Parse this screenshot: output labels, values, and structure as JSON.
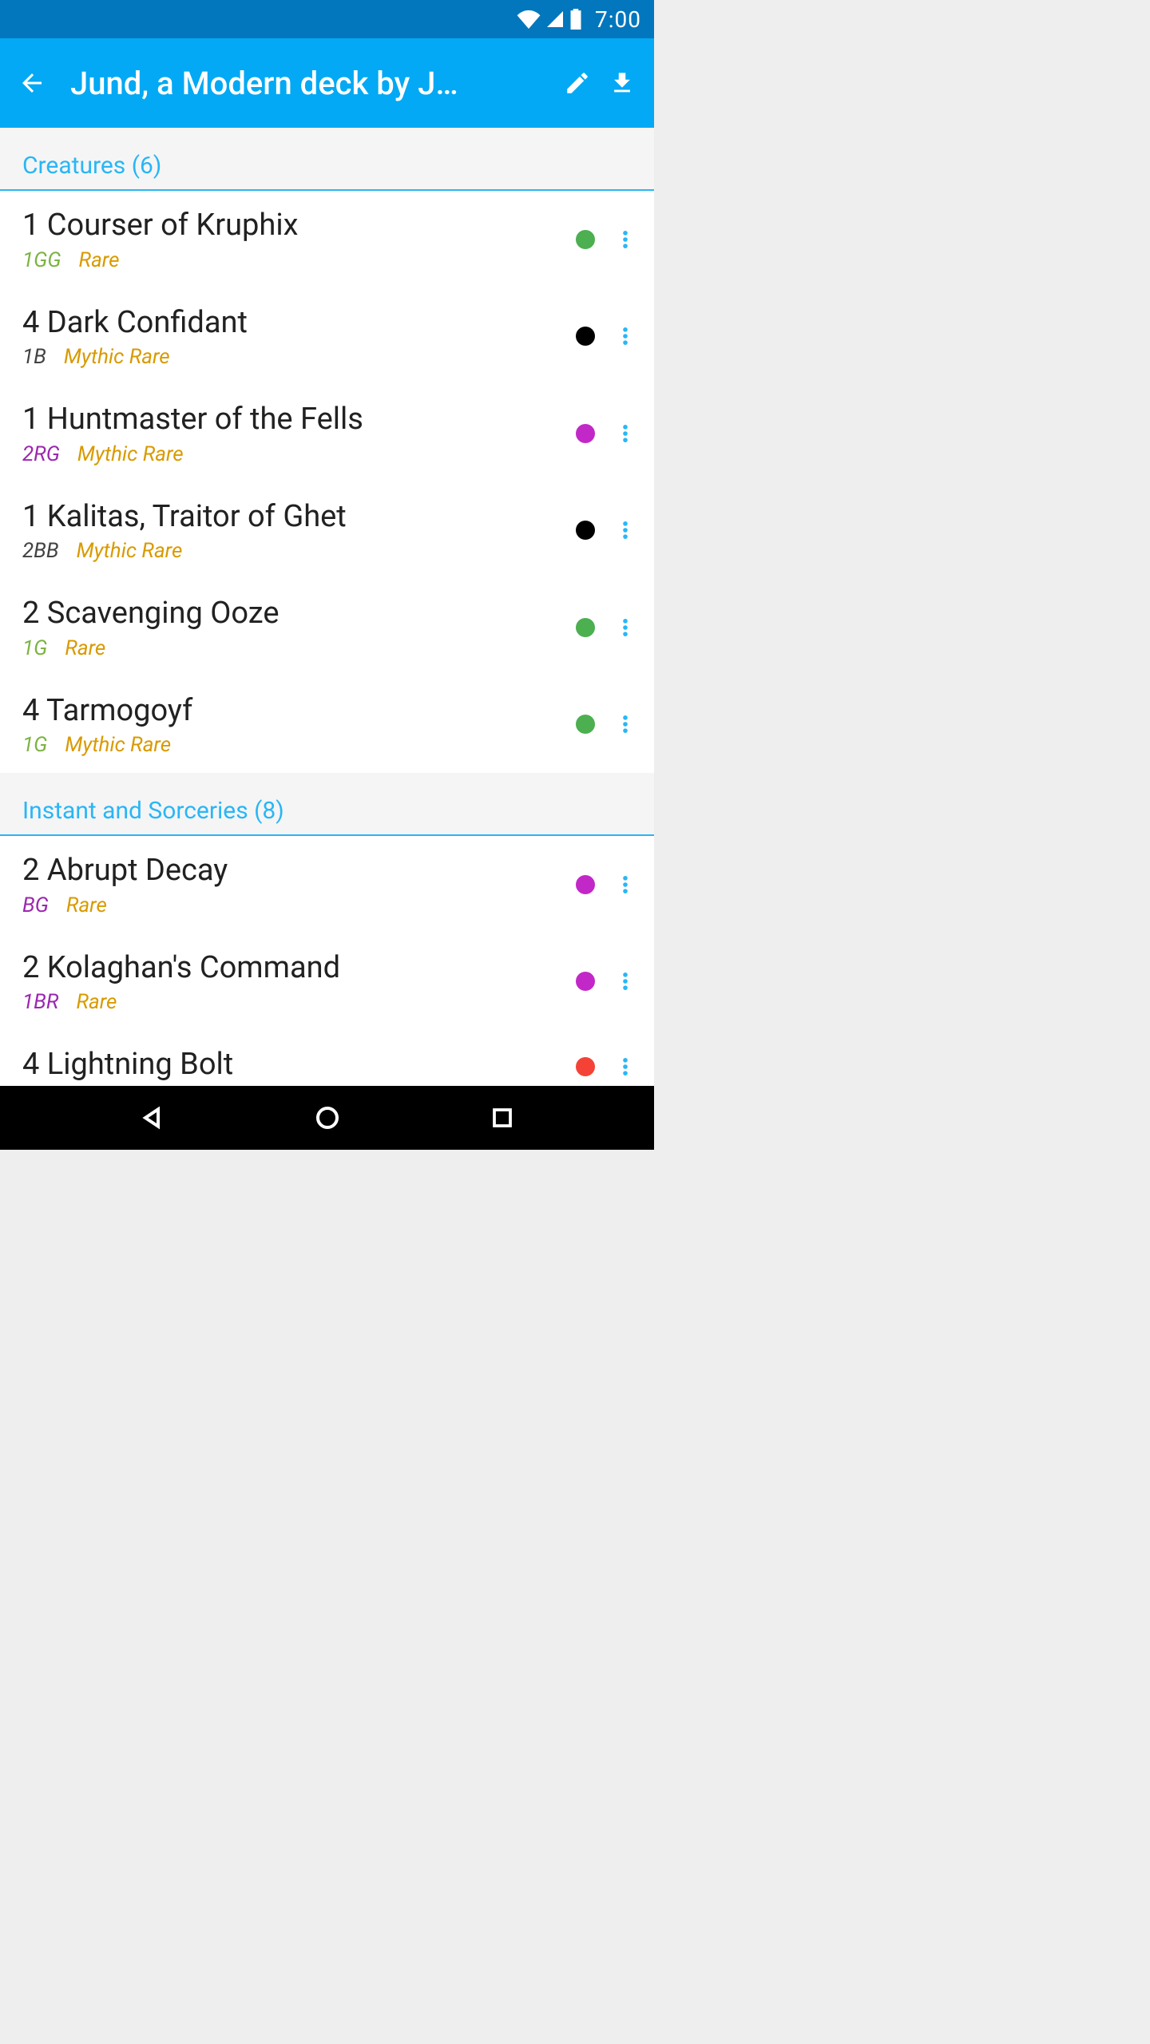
{
  "status_bar": {
    "time": "7:00"
  },
  "app_bar": {
    "title": "Jund, a Modern deck by J…"
  },
  "sections": [
    {
      "header": "Creatures (6)",
      "cards": [
        {
          "title": "1 Courser of Kruphix",
          "cost": "1GG",
          "cost_class": "cost-green",
          "rarity": "Rare",
          "dot": "dot-green"
        },
        {
          "title": "4 Dark Confidant",
          "cost": "1B",
          "cost_class": "cost-black",
          "rarity": "Mythic Rare",
          "dot": "dot-black"
        },
        {
          "title": "1 Huntmaster of the Fells",
          "cost": "2RG",
          "cost_class": "cost-multi",
          "rarity": "Mythic Rare",
          "dot": "dot-purple"
        },
        {
          "title": "1 Kalitas, Traitor of Ghet",
          "cost": "2BB",
          "cost_class": "cost-black",
          "rarity": "Mythic Rare",
          "dot": "dot-black"
        },
        {
          "title": "2 Scavenging Ooze",
          "cost": "1G",
          "cost_class": "cost-green",
          "rarity": "Rare",
          "dot": "dot-green"
        },
        {
          "title": "4 Tarmogoyf",
          "cost": "1G",
          "cost_class": "cost-green",
          "rarity": "Mythic Rare",
          "dot": "dot-green"
        }
      ]
    },
    {
      "header": "Instant and Sorceries (8)",
      "cards": [
        {
          "title": "2 Abrupt Decay",
          "cost": "BG",
          "cost_class": "cost-multi",
          "rarity": "Rare",
          "dot": "dot-purple"
        },
        {
          "title": "2 Kolaghan's Command",
          "cost": "1BR",
          "cost_class": "cost-multi",
          "rarity": "Rare",
          "dot": "dot-purple"
        },
        {
          "title": "4 Lightning Bolt",
          "cost": "",
          "cost_class": "cost-red",
          "rarity": "",
          "dot": "dot-red"
        }
      ]
    }
  ]
}
